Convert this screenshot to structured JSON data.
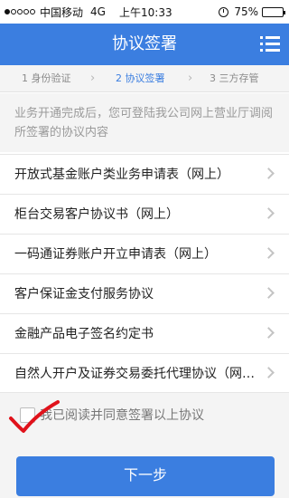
{
  "status_bar": {
    "signal_dots": [
      true,
      false,
      false,
      false,
      false
    ],
    "carrier": "中国移动",
    "network": "4G",
    "time": "上午10:33",
    "battery_percent_text": "75%",
    "battery_level": 0.75
  },
  "header": {
    "title": "协议签署",
    "menu_icon": "menu-icon"
  },
  "steps": [
    {
      "label": "1 身份验证",
      "active": false
    },
    {
      "label": "2 协议签署",
      "active": true
    },
    {
      "label": "3 三方存管",
      "active": false
    }
  ],
  "step_separator": "›",
  "notice": "业务开通完成后，您可登陆我公司网上营业厅调阅所签署的协议内容",
  "agreements": [
    "开放式基金账户类业务申请表（网上）",
    "柜台交易客户协议书（网上）",
    "一码通证券账户开立申请表（网上）",
    "客户保证金支付服务协议",
    "金融产品电子签名约定书",
    "自然人开户及证券交易委托代理协议（网上）"
  ],
  "agree_text": "我已阅读并同意签署以上协议",
  "agree_checked": false,
  "next_button": "下一步",
  "colors": {
    "accent": "#3b7ee0",
    "background": "#f4f4f4",
    "annotation": "#e0121b"
  }
}
